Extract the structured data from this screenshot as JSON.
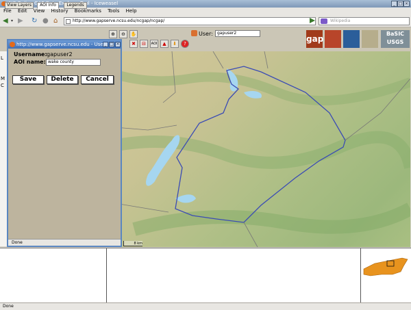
{
  "browser": {
    "title": "NC Online GAP Data Explorer Tool - Iceweasel",
    "menu": [
      "File",
      "Edit",
      "View",
      "History",
      "Bookmarks",
      "Tools",
      "Help"
    ],
    "url": "http://www.gapserve.ncsu.edu/ncgap/ncgap/",
    "search_placeholder": "Wikipedia",
    "status": "Done"
  },
  "app": {
    "tabs": [
      "View Layers",
      "AOI Info",
      "Legends"
    ],
    "user_label": "User:",
    "user_value": "gapuser2",
    "logo_text": "gap",
    "basic_text": "BaSIC",
    "usgs_text": "USGS",
    "scale_label": "8 km",
    "left_panel_letters": [
      "L",
      "M",
      "C"
    ]
  },
  "popup": {
    "title": "http://www.gapserve.ncsu.edu - Use",
    "username_label": "Username:",
    "username_value": "gapuser2",
    "aoi_label": "AOI name:",
    "aoi_value": "wake county",
    "buttons": [
      "Save",
      "Delete",
      "Cancel"
    ],
    "status": "Done"
  },
  "colors": {
    "accent": "#3d6fb6",
    "water": "#a6d6f0",
    "county_border": "#3a4bb5",
    "nc_orange": "#e8931e"
  }
}
